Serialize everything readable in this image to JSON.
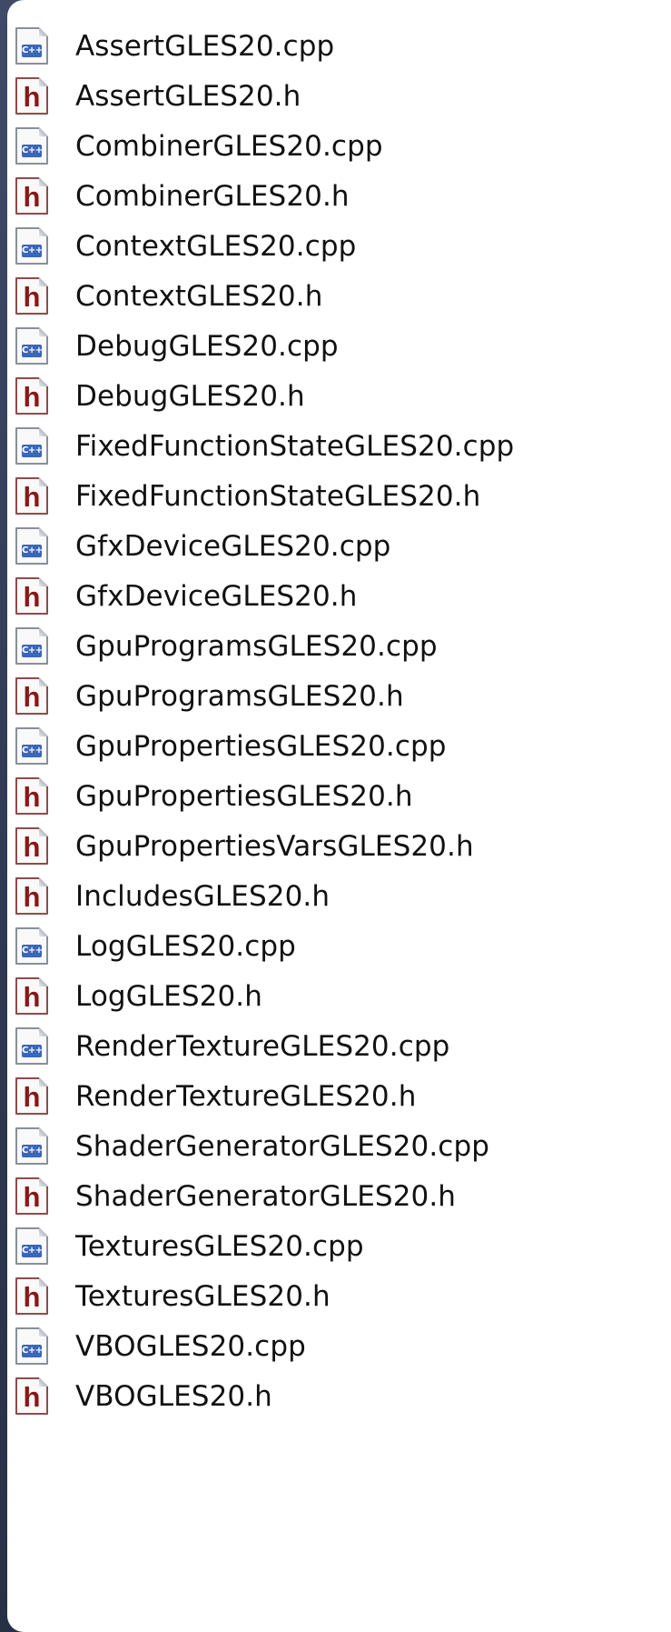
{
  "files": [
    {
      "name": "AssertGLES20.cpp",
      "type": "cpp",
      "icon": "cpp-file-icon",
      "icon_glyph": "C++"
    },
    {
      "name": "AssertGLES20.h",
      "type": "h",
      "icon": "header-file-icon",
      "icon_glyph": "h"
    },
    {
      "name": "CombinerGLES20.cpp",
      "type": "cpp",
      "icon": "cpp-file-icon",
      "icon_glyph": "C++"
    },
    {
      "name": "CombinerGLES20.h",
      "type": "h",
      "icon": "header-file-icon",
      "icon_glyph": "h"
    },
    {
      "name": "ContextGLES20.cpp",
      "type": "cpp",
      "icon": "cpp-file-icon",
      "icon_glyph": "C++"
    },
    {
      "name": "ContextGLES20.h",
      "type": "h",
      "icon": "header-file-icon",
      "icon_glyph": "h"
    },
    {
      "name": "DebugGLES20.cpp",
      "type": "cpp",
      "icon": "cpp-file-icon",
      "icon_glyph": "C++"
    },
    {
      "name": "DebugGLES20.h",
      "type": "h",
      "icon": "header-file-icon",
      "icon_glyph": "h"
    },
    {
      "name": "FixedFunctionStateGLES20.cpp",
      "type": "cpp",
      "icon": "cpp-file-icon",
      "icon_glyph": "C++"
    },
    {
      "name": "FixedFunctionStateGLES20.h",
      "type": "h",
      "icon": "header-file-icon",
      "icon_glyph": "h"
    },
    {
      "name": "GfxDeviceGLES20.cpp",
      "type": "cpp",
      "icon": "cpp-file-icon",
      "icon_glyph": "C++"
    },
    {
      "name": "GfxDeviceGLES20.h",
      "type": "h",
      "icon": "header-file-icon",
      "icon_glyph": "h"
    },
    {
      "name": "GpuProgramsGLES20.cpp",
      "type": "cpp",
      "icon": "cpp-file-icon",
      "icon_glyph": "C++"
    },
    {
      "name": "GpuProgramsGLES20.h",
      "type": "h",
      "icon": "header-file-icon",
      "icon_glyph": "h"
    },
    {
      "name": "GpuPropertiesGLES20.cpp",
      "type": "cpp",
      "icon": "cpp-file-icon",
      "icon_glyph": "C++"
    },
    {
      "name": "GpuPropertiesGLES20.h",
      "type": "h",
      "icon": "header-file-icon",
      "icon_glyph": "h"
    },
    {
      "name": "GpuPropertiesVarsGLES20.h",
      "type": "h",
      "icon": "header-file-icon",
      "icon_glyph": "h"
    },
    {
      "name": "IncludesGLES20.h",
      "type": "h",
      "icon": "header-file-icon",
      "icon_glyph": "h"
    },
    {
      "name": "LogGLES20.cpp",
      "type": "cpp",
      "icon": "cpp-file-icon",
      "icon_glyph": "C++"
    },
    {
      "name": "LogGLES20.h",
      "type": "h",
      "icon": "header-file-icon",
      "icon_glyph": "h"
    },
    {
      "name": "RenderTextureGLES20.cpp",
      "type": "cpp",
      "icon": "cpp-file-icon",
      "icon_glyph": "C++"
    },
    {
      "name": "RenderTextureGLES20.h",
      "type": "h",
      "icon": "header-file-icon",
      "icon_glyph": "h"
    },
    {
      "name": "ShaderGeneratorGLES20.cpp",
      "type": "cpp",
      "icon": "cpp-file-icon",
      "icon_glyph": "C++"
    },
    {
      "name": "ShaderGeneratorGLES20.h",
      "type": "h",
      "icon": "header-file-icon",
      "icon_glyph": "h"
    },
    {
      "name": "TexturesGLES20.cpp",
      "type": "cpp",
      "icon": "cpp-file-icon",
      "icon_glyph": "C++"
    },
    {
      "name": "TexturesGLES20.h",
      "type": "h",
      "icon": "header-file-icon",
      "icon_glyph": "h"
    },
    {
      "name": "VBOGLES20.cpp",
      "type": "cpp",
      "icon": "cpp-file-icon",
      "icon_glyph": "C++"
    },
    {
      "name": "VBOGLES20.h",
      "type": "h",
      "icon": "header-file-icon",
      "icon_glyph": "h"
    }
  ],
  "colors": {
    "panel_background": "#ffffff",
    "page_background": "#000000",
    "side_strip": "#34405a",
    "cpp_badge": "#3b67b8",
    "header_h": "#8a1717",
    "text": "#111111"
  }
}
